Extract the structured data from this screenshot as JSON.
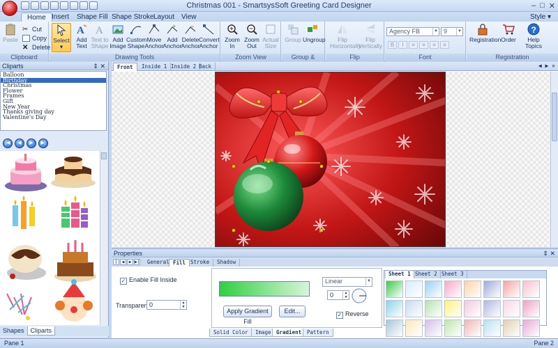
{
  "window": {
    "title": "Christmas 001 - SmartsysSoft Greeting Card Designer",
    "controls": [
      "–",
      "□",
      "✕"
    ]
  },
  "tabs": [
    "Home",
    "Insert",
    "Shape Fill",
    "Shape Stroke",
    "Layout",
    "View"
  ],
  "style_menu": "Style ▾",
  "ribbon": {
    "clipboard": {
      "label": "Clipboard",
      "paste": "Paste",
      "cut": "Cut",
      "copy": "Copy",
      "delete": "Delete"
    },
    "drawing": {
      "label": "Drawing Tools",
      "select": "Select",
      "add_text": "Add Text",
      "text_to_shape": "Text to Shape",
      "add_image": "Add Image",
      "custom_shape": "Custom Shape",
      "move_anchor": "Move Anchor",
      "add_anchor": "Add Anchor",
      "delete_anchor": "Delete Anchor",
      "convert_anchor": "Convert Anchor"
    },
    "zoom": {
      "label": "Zoom View",
      "zoom_in": "Zoom In",
      "zoom_out": "Zoom Out",
      "actual_size": "Actual Size"
    },
    "group": {
      "label": "Group & Ungroup",
      "group": "Group",
      "ungroup": "Ungroup"
    },
    "flip": {
      "label": "Flip",
      "horizontal": "Flip Horizontally",
      "vertical": "Flip Vertically"
    },
    "font": {
      "label": "Font",
      "family": "Agency FB",
      "size": "9",
      "format_buttons": [
        "B",
        "I",
        "≡",
        "≡",
        "≡",
        "≡"
      ]
    },
    "registration": {
      "label": "Registration",
      "registration": "Registration",
      "order": "Order",
      "help": "Help Topics"
    }
  },
  "cliparts_panel": {
    "title": "Cliparts",
    "categories": [
      "Balloon",
      "Birthday",
      "Christmas",
      "Flower",
      "Frames",
      "Gift",
      "New Year",
      "Thanks giving day",
      "Valentine's Day"
    ],
    "selected": "Birthday",
    "bottom_tabs": [
      "Shapes",
      "Cliparts"
    ]
  },
  "document": {
    "tabs": [
      "Front",
      "Inside 1",
      "Inside 2",
      "Back"
    ],
    "active_tab": "Front"
  },
  "properties": {
    "title": "Properties",
    "tabs": [
      "General",
      "Fill",
      "Stroke",
      "Shadow"
    ],
    "active_tab": "Fill",
    "enable_fill_inside": "Enable Fill Inside",
    "transparency_label": "Transparency",
    "transparency_value": "0",
    "gradient_type": "Linear",
    "angle_value": "0",
    "reverse_label": "Reverse",
    "apply_button": "Apply Gradient Fill",
    "edit_button": "Edit...",
    "fill_tabs": [
      "Solid Color",
      "Image",
      "Gradient",
      "Pattern"
    ],
    "active_fill_tab": "Gradient",
    "sheets": [
      "Sheet 1",
      "Sheet 2",
      "Sheet 3"
    ],
    "swatch_colors": [
      [
        "#3cc94a",
        "#d7ecff",
        "#9ad0f5",
        "#f7a8c8",
        "#ffd3a6",
        "#9fa9d8",
        "#f6a3a3",
        "#f5c2cf"
      ],
      [
        "#8cd3e6",
        "#c8d9f2",
        "#b9e0b2",
        "#fff27a",
        "#f4c7df",
        "#b0b8de",
        "#f7d6e4",
        "#eba2c3"
      ],
      [
        "#a7c7d8",
        "#f9e8ba",
        "#d4c0e8",
        "#bfe6a9",
        "#f2b4b4",
        "#b8e0f0",
        "#e0d0b0",
        "#e8a8d8"
      ]
    ]
  },
  "status": {
    "left": "Pane 1",
    "right": "Pane 2"
  }
}
